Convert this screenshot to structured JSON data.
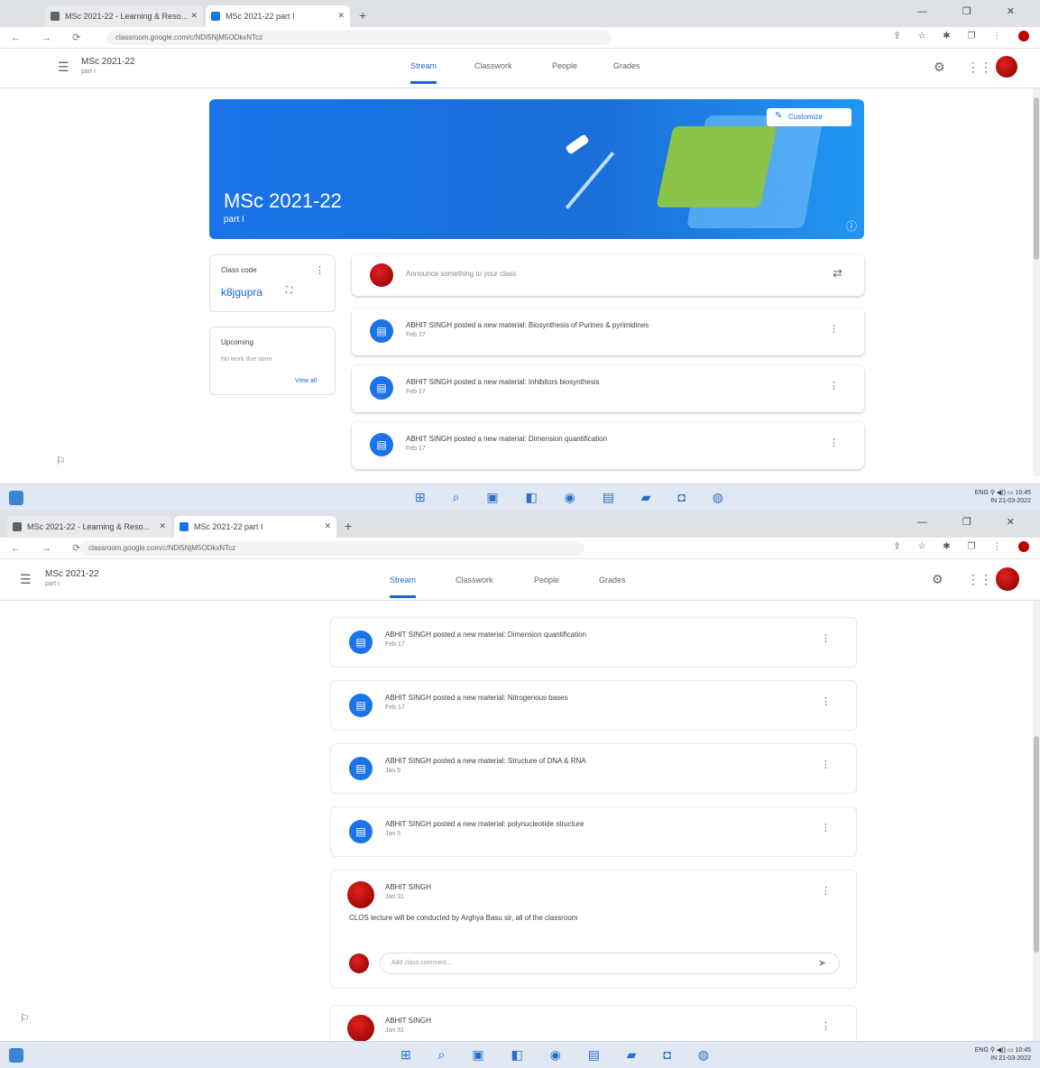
{
  "browser": {
    "tab1": {
      "label": "MSc 2021-22 - Learning & Reso..."
    },
    "tab2": {
      "label": "MSc 2021-22 part I"
    },
    "new_tab": "+",
    "window_controls": "— ❐ ✕",
    "nav": "← → ⟳",
    "url": "classroom.google.com/c/NDI5NjM5ODkxNTcz",
    "ext_icons": "⇪ ☆ ✱ ❐ ⋮"
  },
  "classroom": {
    "class_title": "MSc 2021-22",
    "class_section": "part I",
    "tabs": [
      "Stream",
      "Classwork",
      "People",
      "Grades"
    ],
    "banner": {
      "title": "MSc 2021-22",
      "section": "part I",
      "customize": "Customize"
    },
    "class_code": {
      "label": "Class code",
      "value": "k8jgupra"
    },
    "upcoming": {
      "label": "Upcoming",
      "text": "No work due soon",
      "view_all": "View all"
    },
    "announce_placeholder": "Announce something to your class",
    "posts_top": [
      {
        "text": "ABHIT SINGH posted a new material: Biosynthesis of Purines & pyrimidines",
        "date": "Feb 17"
      },
      {
        "text": "ABHIT SINGH posted a new material: Inhibitors biosynthesis",
        "date": "Feb 17"
      },
      {
        "text": "ABHIT SINGH posted a new material: Dimension quantification",
        "date": "Feb 17"
      }
    ],
    "posts_bottom": [
      {
        "text": "ABHIT SINGH posted a new material: Dimension quantification",
        "date": "Feb 17"
      },
      {
        "text": "ABHIT SINGH posted a new material: Nitrogenous bases",
        "date": "Feb 17"
      },
      {
        "text": "ABHIT SINGH posted a new material: Structure of DNA & RNA",
        "date": "Jan 5"
      },
      {
        "text": "ABHIT SINGH posted a new material: polynucleotide structure",
        "date": "Jan 5"
      }
    ],
    "announcement": {
      "author": "ABHIT SINGH",
      "date": "Jan 31",
      "body": "CLOS lecture will be conducted by Arghya Basu sir, all of the classroom",
      "comment_placeholder": "Add class comment..."
    },
    "last_post": {
      "author": "ABHIT SINGH",
      "date": "Jan 31"
    }
  },
  "taskbar": {
    "icons": "⊞ ⌕ ▣ ◧ ◉ ▤ ▰ ◘ ◍",
    "tray_top": "ENG  ⚲ ◀)) ▭  10:45",
    "tray_bottom": "IN         21-03-2022"
  },
  "colors": {
    "accent": "#1a73e8",
    "banner": "#1b6fd8",
    "avatar": "#c01010"
  }
}
